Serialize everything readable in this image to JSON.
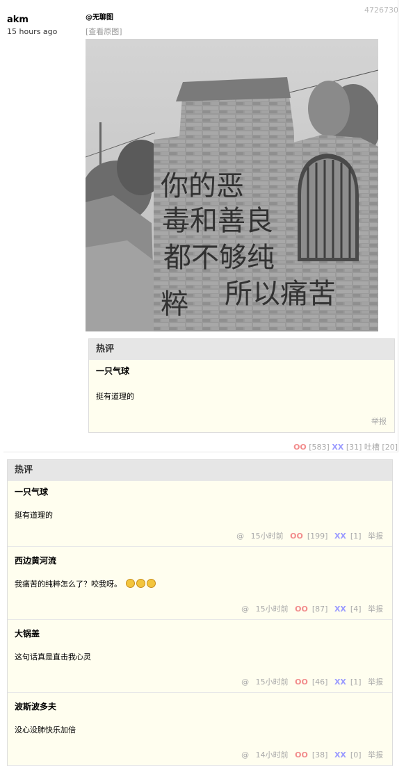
{
  "post": {
    "id": "4726730",
    "author": "akm",
    "time": "15 hours ago",
    "mention": "@无聊图",
    "view_original": "[查看原图]",
    "photo_icon": "graffiti-wall-photo",
    "photo_text": [
      "你的恶",
      "毒和善良",
      "都不够纯",
      "粹",
      "所以痛苦"
    ],
    "hot_title": "热评",
    "hot_comment": {
      "name": "一只气球",
      "text": "挺有道理的",
      "report": "举报"
    },
    "stats": {
      "oo": "OO",
      "oo_count": "[583]",
      "xx": "XX",
      "xx_count": "[31]",
      "tucao": "吐槽 [20]"
    }
  },
  "comments_section": {
    "title": "热评",
    "items": [
      {
        "name": "一只气球",
        "text": "挺有道理的",
        "at": "@",
        "time": "15小时前",
        "oo": "OO",
        "oo_count": "[199]",
        "xx": "XX",
        "xx_count": "[1]",
        "report": "举报",
        "emojis": 0
      },
      {
        "name": "西边黄河流",
        "text": "我痛苦的纯粹怎么了？咬我呀。",
        "at": "@",
        "time": "15小时前",
        "oo": "OO",
        "oo_count": "[87]",
        "xx": "XX",
        "xx_count": "[4]",
        "report": "举报",
        "emojis": 3
      },
      {
        "name": "大锅盖",
        "text": "这句话真是直击我心灵",
        "at": "@",
        "time": "15小时前",
        "oo": "OO",
        "oo_count": "[46]",
        "xx": "XX",
        "xx_count": "[1]",
        "report": "举报",
        "emojis": 0
      },
      {
        "name": "波斯波多夫",
        "text": "没心没肺快乐加倍",
        "at": "@",
        "time": "14小时前",
        "oo": "OO",
        "oo_count": "[38]",
        "xx": "XX",
        "xx_count": "[0]",
        "report": "举报",
        "emojis": 0
      }
    ]
  },
  "colors": {
    "oo": "#f28b8b",
    "xx": "#9b9bff",
    "card_bg": "#fffeef",
    "header_bg": "#e6e6e6"
  }
}
